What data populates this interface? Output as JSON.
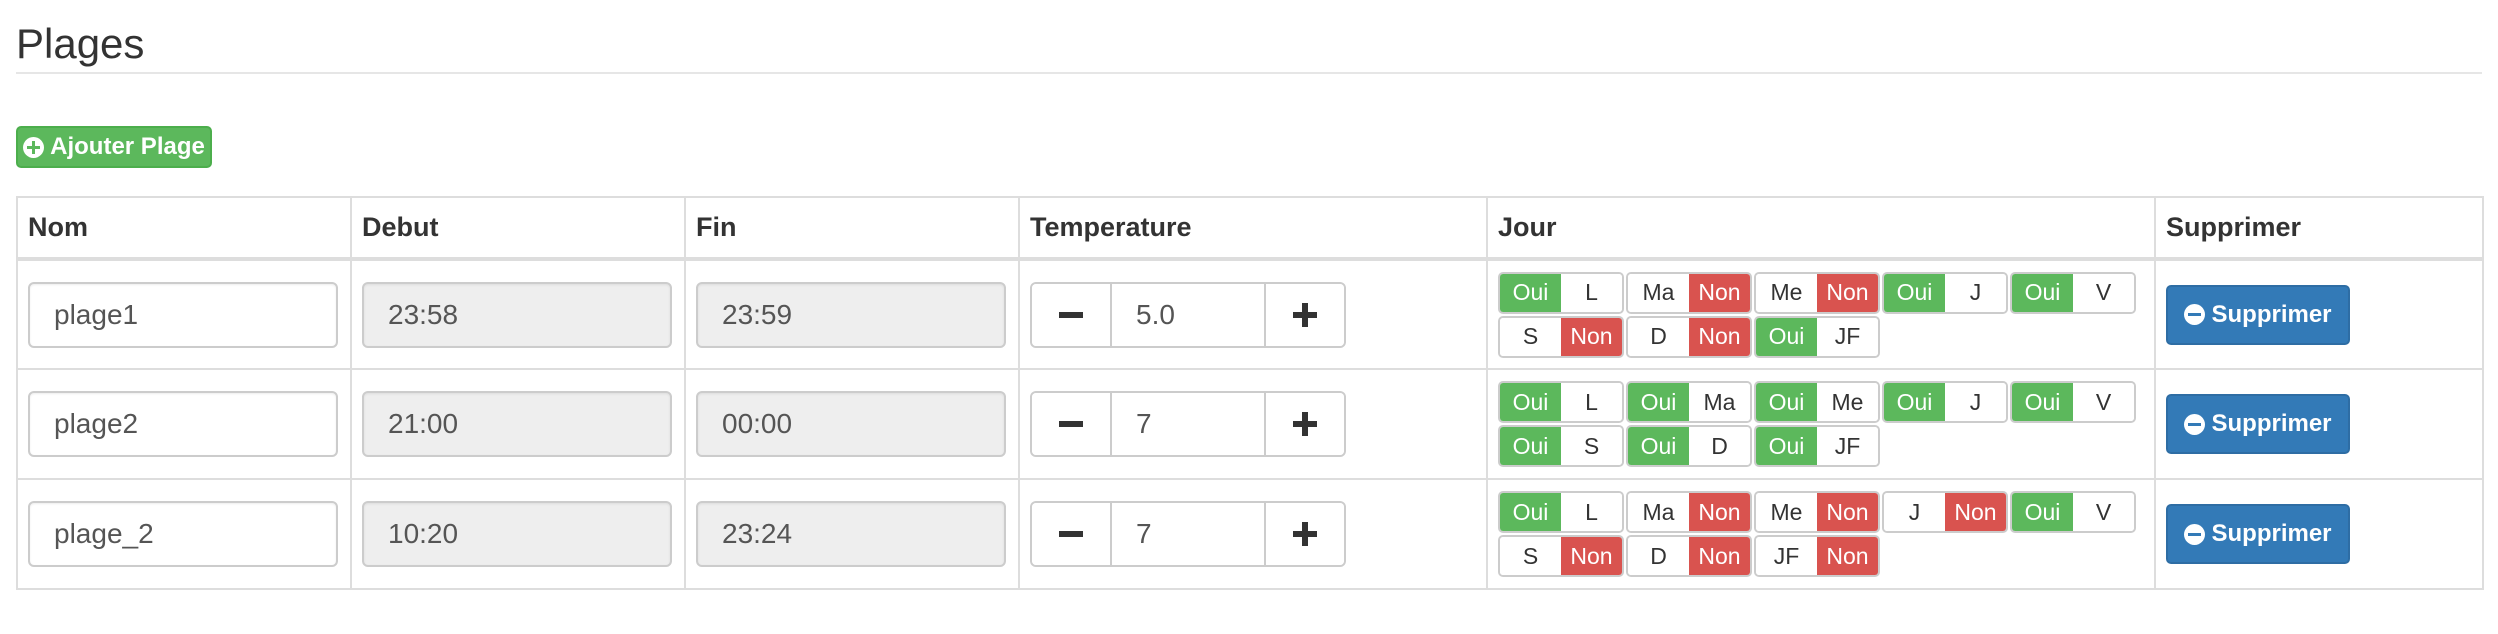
{
  "section": {
    "title": "Plages"
  },
  "toolbar": {
    "add_label": "Ajouter Plage"
  },
  "table": {
    "headers": [
      "Nom",
      "Debut",
      "Fin",
      "Temperature",
      "Jour",
      "Supprimer"
    ],
    "delete_label": "Supprimer",
    "rows": [
      {
        "name": "plage1",
        "debut": "23:58",
        "fin": "23:59",
        "temperature": "5.0",
        "days": [
          {
            "label": "L",
            "state": "Oui"
          },
          {
            "label": "Ma",
            "state": "Non"
          },
          {
            "label": "Me",
            "state": "Non"
          },
          {
            "label": "J",
            "state": "Oui"
          },
          {
            "label": "V",
            "state": "Oui"
          },
          {
            "label": "S",
            "state": "Non"
          },
          {
            "label": "D",
            "state": "Non"
          },
          {
            "label": "JF",
            "state": "Oui"
          }
        ]
      },
      {
        "name": "plage2",
        "debut": "21:00",
        "fin": "00:00",
        "temperature": "7",
        "days": [
          {
            "label": "L",
            "state": "Oui"
          },
          {
            "label": "Ma",
            "state": "Oui"
          },
          {
            "label": "Me",
            "state": "Oui"
          },
          {
            "label": "J",
            "state": "Oui"
          },
          {
            "label": "V",
            "state": "Oui"
          },
          {
            "label": "S",
            "state": "Oui"
          },
          {
            "label": "D",
            "state": "Oui"
          },
          {
            "label": "JF",
            "state": "Oui"
          }
        ]
      },
      {
        "name": "plage_2",
        "debut": "10:20",
        "fin": "23:24",
        "temperature": "7",
        "days": [
          {
            "label": "L",
            "state": "Oui"
          },
          {
            "label": "Ma",
            "state": "Non"
          },
          {
            "label": "Me",
            "state": "Non"
          },
          {
            "label": "J",
            "state": "Non"
          },
          {
            "label": "V",
            "state": "Oui"
          },
          {
            "label": "S",
            "state": "Non"
          },
          {
            "label": "D",
            "state": "Non"
          },
          {
            "label": "JF",
            "state": "Non"
          }
        ]
      }
    ]
  },
  "colors": {
    "success": "#5cb85c",
    "danger": "#d9534f",
    "primary": "#337ab7"
  },
  "icons": {
    "add": "plus-circle-icon",
    "delete": "minus-circle-icon",
    "decrement": "minus-icon",
    "increment": "plus-icon"
  }
}
